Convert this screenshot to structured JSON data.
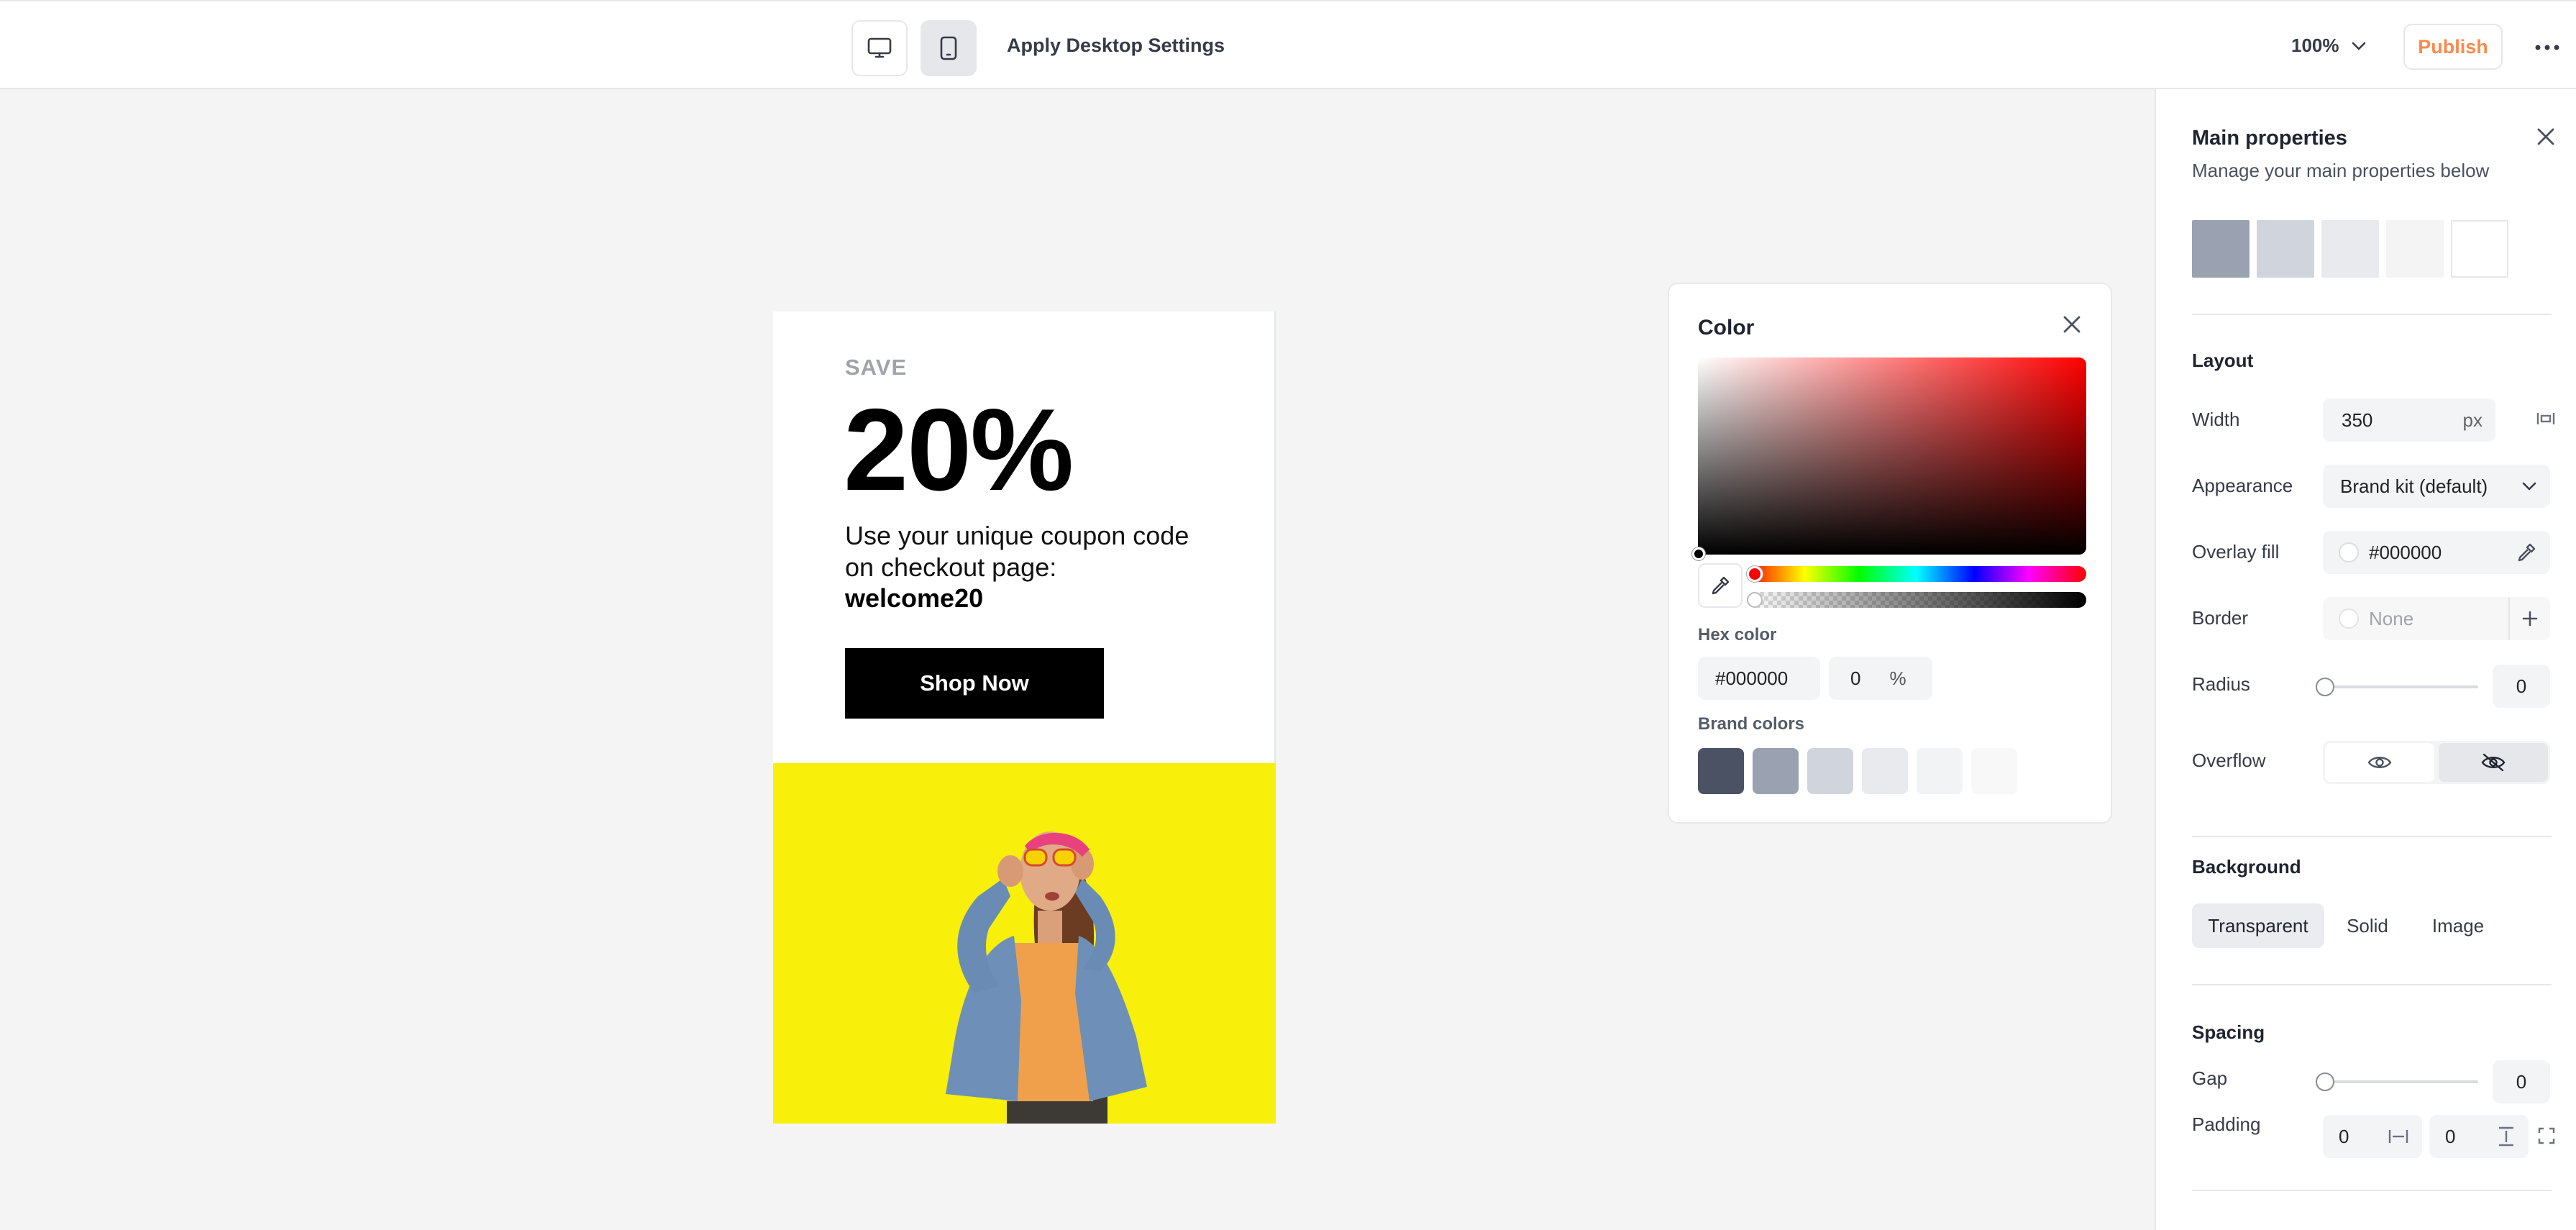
{
  "topbar": {
    "apply_label": "Apply Desktop Settings",
    "zoom": "100%",
    "publish_label": "Publish",
    "accent_color": "#fb8a4c"
  },
  "popup": {
    "save_label": "SAVE",
    "headline": "20%",
    "body_text": "Use your unique coupon code on  checkout page:",
    "coupon_code": "welcome20",
    "cta_label": "Shop Now",
    "image_background": "#f8ef0b"
  },
  "color_picker": {
    "title": "Color",
    "hex_label": "Hex color",
    "hex_value": "#000000",
    "alpha_value": "0",
    "alpha_unit": "%",
    "brand_label": "Brand colors",
    "brand_colors": [
      "#4b5263",
      "#9aa2b1",
      "#d0d4dc",
      "#e9eaed",
      "#f2f3f5",
      "#f8f8f9"
    ]
  },
  "panel": {
    "title": "Main properties",
    "subtitle": "Manage your main properties below",
    "palette": [
      "#9aa2b1",
      "#d0d4dc",
      "#e9eaed",
      "#f4f4f5",
      "#ffffff"
    ],
    "layout": {
      "title": "Layout",
      "width_label": "Width",
      "width_value": "350",
      "width_unit": "px",
      "appearance_label": "Appearance",
      "appearance_value": "Brand kit (default)",
      "overlay_label": "Overlay fill",
      "overlay_value": "#000000",
      "border_label": "Border",
      "border_value": "None",
      "radius_label": "Radius",
      "radius_value": "0",
      "overflow_label": "Overflow"
    },
    "background": {
      "title": "Background",
      "tabs": [
        "Transparent",
        "Solid",
        "Image"
      ],
      "active_tab": "Transparent"
    },
    "spacing": {
      "title": "Spacing",
      "gap_label": "Gap",
      "gap_value": "0",
      "padding_label": "Padding",
      "padding_h": "0",
      "padding_v": "0"
    }
  }
}
